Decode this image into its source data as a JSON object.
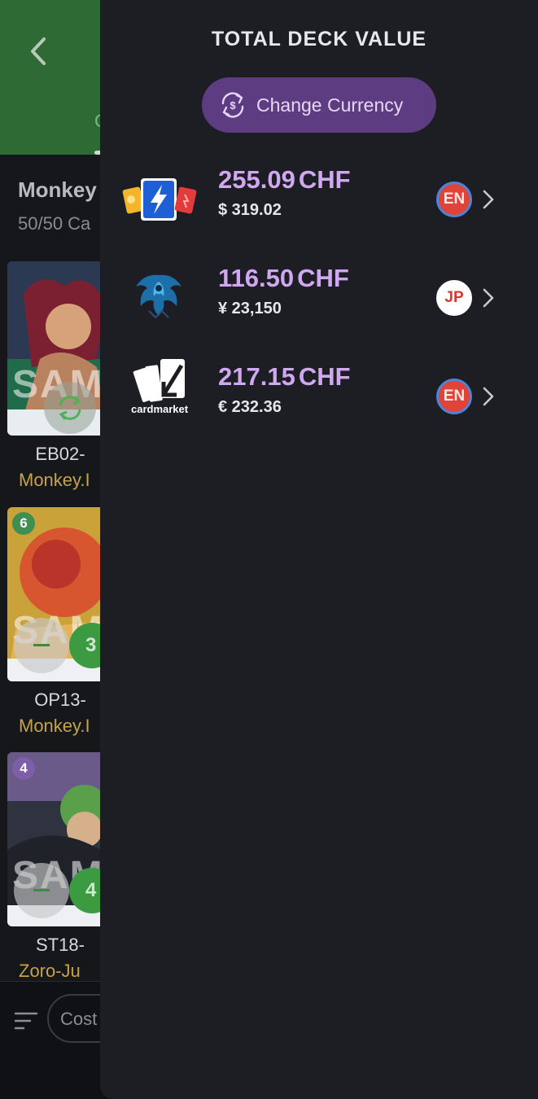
{
  "background": {
    "tab_peek": "C",
    "deck_title": "Monkey",
    "deck_count": "50/50 Ca",
    "cards": [
      {
        "code": "EB02-",
        "name": "Monkey.I",
        "cost_badge": "",
        "qty": ""
      },
      {
        "code": "OP13-",
        "name": "Monkey.I",
        "cost_badge": "6",
        "qty": "3"
      },
      {
        "code": "ST18-",
        "name": "Zoro-Ju",
        "cost_badge": "4",
        "qty": "4"
      }
    ],
    "sample_watermark": "SAM",
    "filter_chip": "Cost"
  },
  "drawer": {
    "title": "TOTAL DECK VALUE",
    "change_currency_label": "Change Currency",
    "markets": [
      {
        "logo": "tcgplayer-logo",
        "price": "255.09",
        "currency": "CHF",
        "sub_price": "$ 319.02",
        "lang": "EN"
      },
      {
        "logo": "phoenix-logo",
        "price": "116.50",
        "currency": "CHF",
        "sub_price": "¥ 23,150",
        "lang": "JP"
      },
      {
        "logo": "cardmarket-logo",
        "logo_text": "cardmarket",
        "price": "217.15",
        "currency": "CHF",
        "sub_price": "€ 232.36",
        "lang": "EN"
      }
    ]
  },
  "colors": {
    "header_green": "#2e6a34",
    "drawer_bg": "#1d1e24",
    "accent_purple": "#5e3c82",
    "price_purple": "#d2a7f1"
  }
}
